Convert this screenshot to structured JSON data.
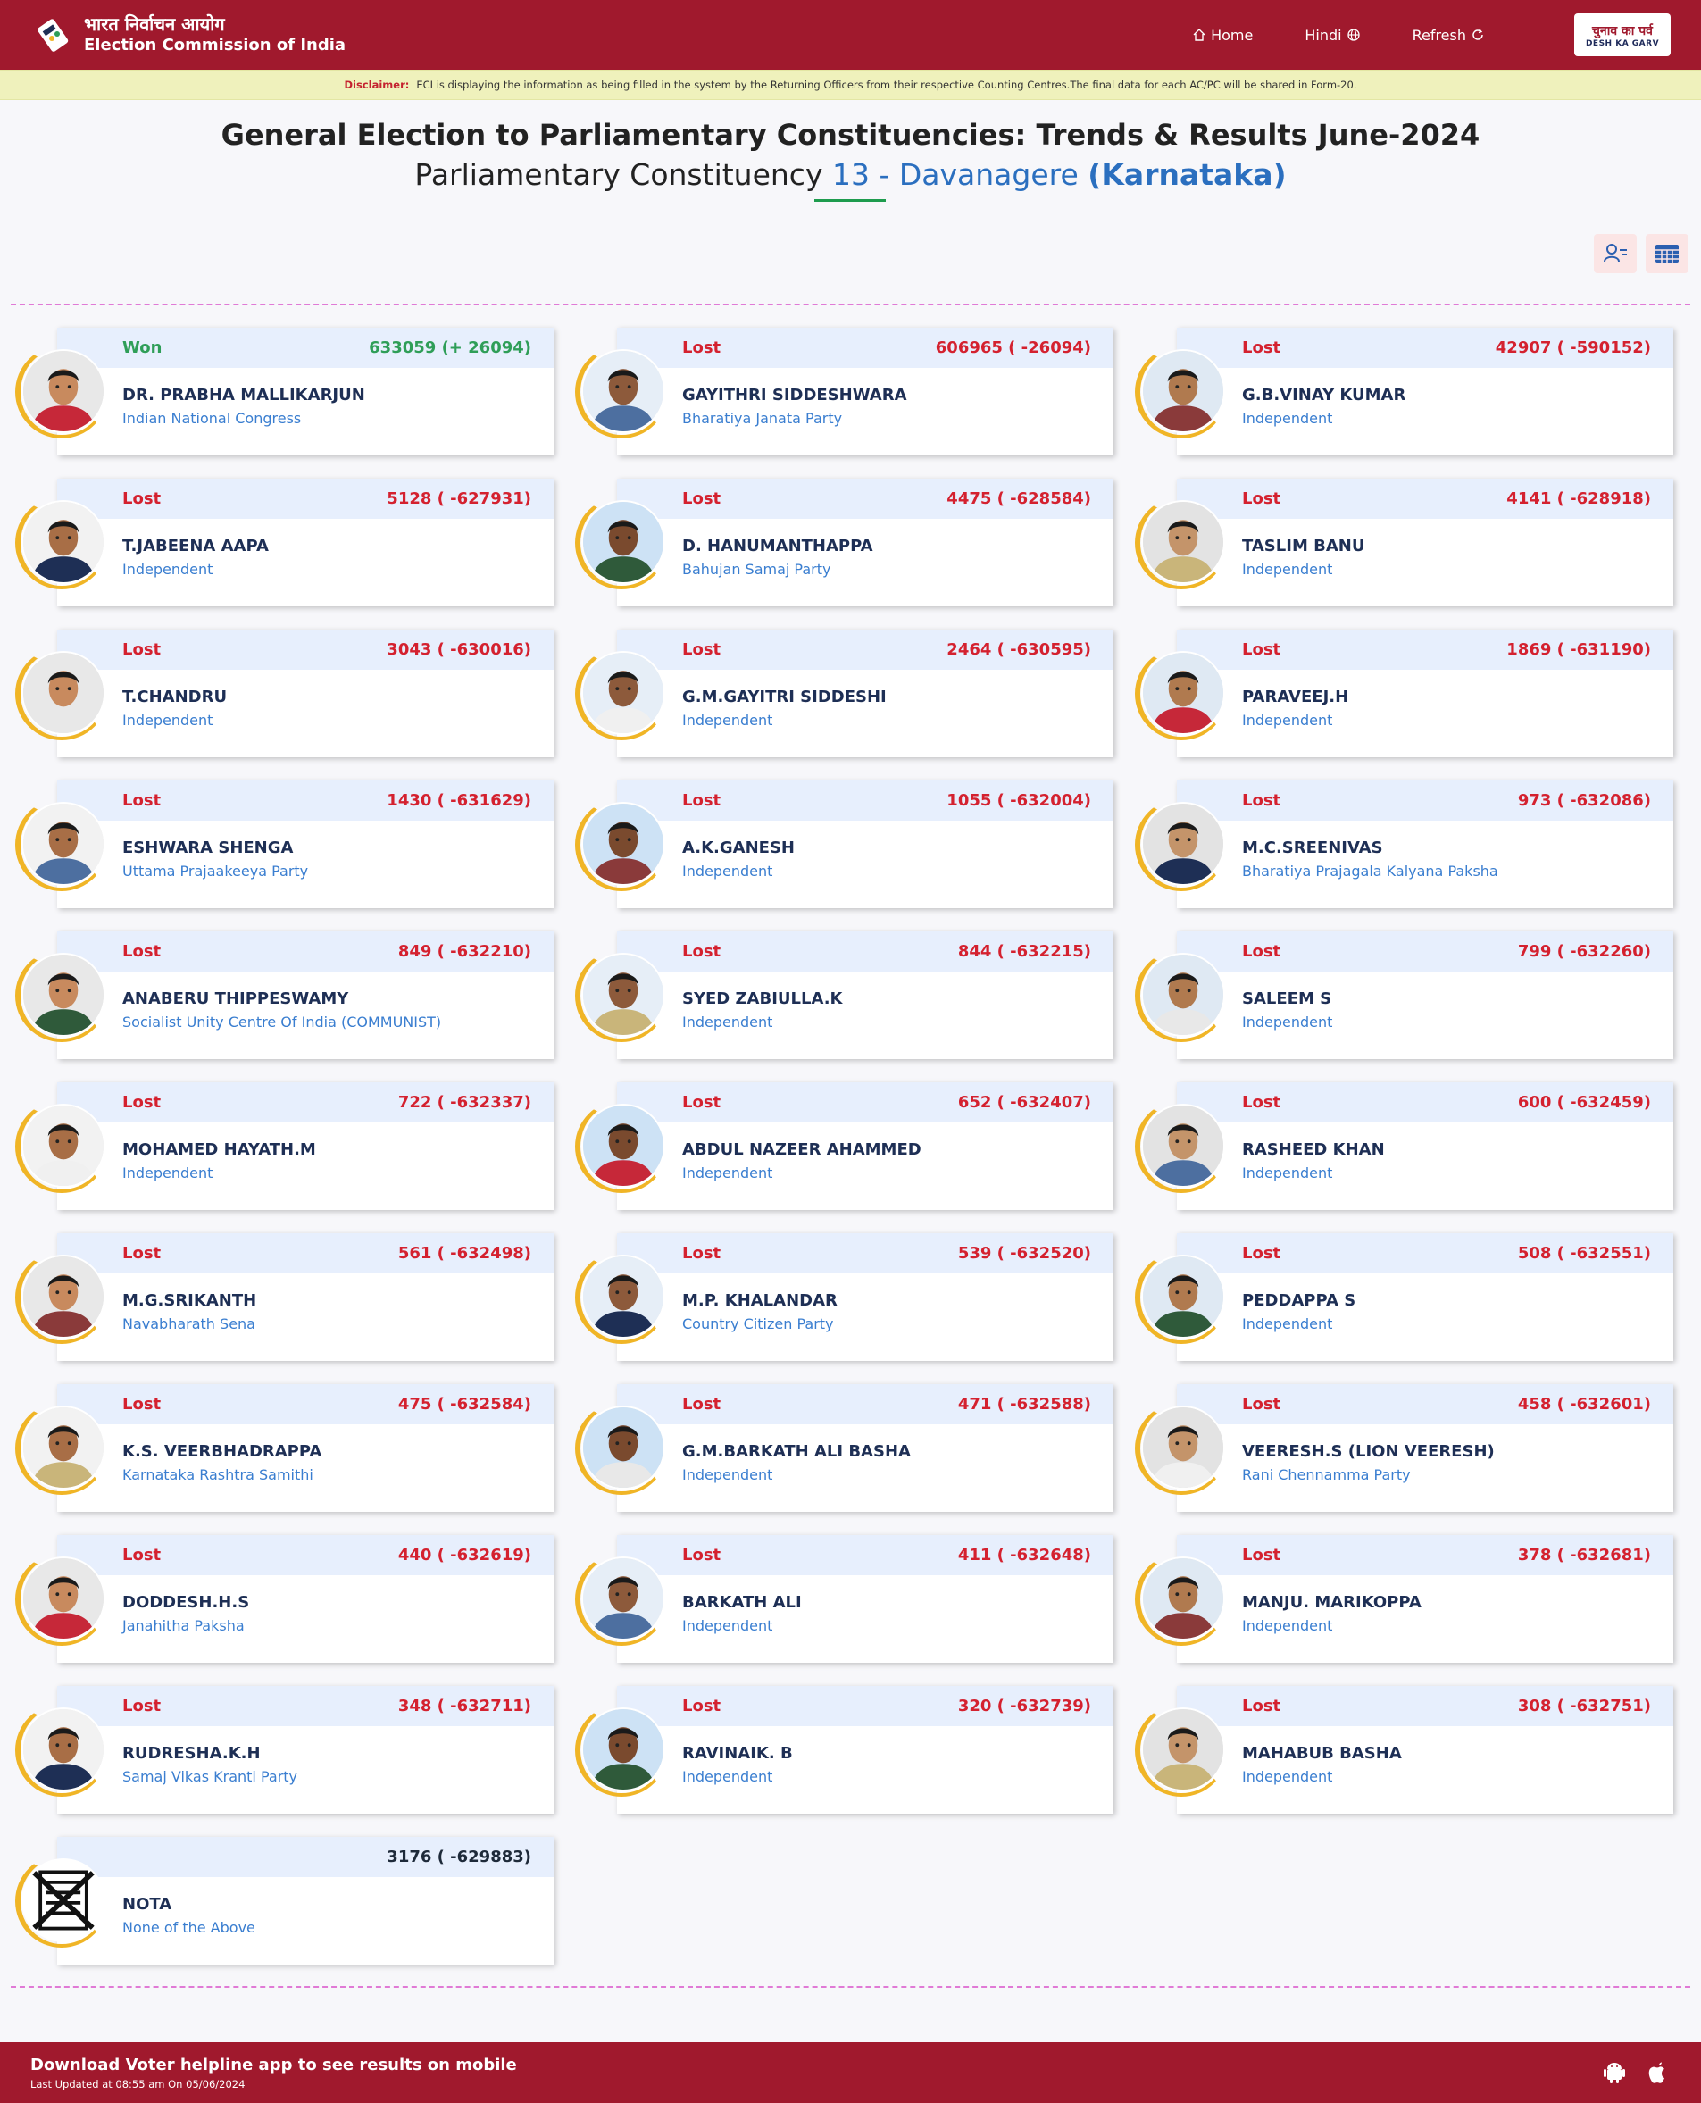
{
  "header": {
    "brand_hi": "भारत निर्वाचन आयोग",
    "brand_en": "Election Commission of India",
    "nav": {
      "home": "Home",
      "hindi": "Hindi",
      "refresh": "Refresh"
    },
    "badge_hi": "चुनाव का पर्व",
    "badge_en": "DESH KA GARV"
  },
  "disclaimer": {
    "label": "Disclaimer:",
    "text": "ECI is displaying the information as being filled in the system by the Returning Officers from their respective Counting Centres.The final data for each AC/PC will be shared in Form-20."
  },
  "page": {
    "title": "General Election to Parliamentary Constituencies: Trends & Results June-2024",
    "subtitle_prefix": "Parliamentary Constituency",
    "constituency": "13 - Davanagere",
    "state": "(Karnataka)"
  },
  "colors": {
    "header": "#a0192d",
    "won": "#2f9e58",
    "lost": "#d4212f",
    "ring": "#f0b526",
    "party": "#3a7ed0"
  },
  "candidates": [
    {
      "status": "Won",
      "votes": "633059 (+ 26094)",
      "name": "DR. PRABHA MALLIKARJUN",
      "party": "Indian National Congress"
    },
    {
      "status": "Lost",
      "votes": "606965 ( -26094)",
      "name": "GAYITHRI SIDDESHWARA",
      "party": "Bharatiya Janata Party"
    },
    {
      "status": "Lost",
      "votes": "42907 ( -590152)",
      "name": "G.B.VINAY KUMAR",
      "party": "Independent"
    },
    {
      "status": "Lost",
      "votes": "5128 ( -627931)",
      "name": "T.JABEENA AAPA",
      "party": "Independent"
    },
    {
      "status": "Lost",
      "votes": "4475 ( -628584)",
      "name": "D. HANUMANTHAPPA",
      "party": "Bahujan Samaj Party"
    },
    {
      "status": "Lost",
      "votes": "4141 ( -628918)",
      "name": "TASLIM BANU",
      "party": "Independent"
    },
    {
      "status": "Lost",
      "votes": "3043 ( -630016)",
      "name": "T.CHANDRU",
      "party": "Independent"
    },
    {
      "status": "Lost",
      "votes": "2464 ( -630595)",
      "name": "G.M.GAYITRI SIDDESHI",
      "party": "Independent"
    },
    {
      "status": "Lost",
      "votes": "1869 ( -631190)",
      "name": "PARAVEEJ.H",
      "party": "Independent"
    },
    {
      "status": "Lost",
      "votes": "1430 ( -631629)",
      "name": "ESHWARA SHENGA",
      "party": "Uttama Prajaakeeya Party"
    },
    {
      "status": "Lost",
      "votes": "1055 ( -632004)",
      "name": "A.K.GANESH",
      "party": "Independent"
    },
    {
      "status": "Lost",
      "votes": "973 ( -632086)",
      "name": "M.C.SREENIVAS",
      "party": "Bharatiya Prajagala Kalyana Paksha"
    },
    {
      "status": "Lost",
      "votes": "849 ( -632210)",
      "name": "ANABERU THIPPESWAMY",
      "party": "Socialist Unity Centre Of India (COMMUNIST)"
    },
    {
      "status": "Lost",
      "votes": "844 ( -632215)",
      "name": "SYED ZABIULLA.K",
      "party": "Independent"
    },
    {
      "status": "Lost",
      "votes": "799 ( -632260)",
      "name": "SALEEM S",
      "party": "Independent"
    },
    {
      "status": "Lost",
      "votes": "722 ( -632337)",
      "name": "MOHAMED HAYATH.M",
      "party": "Independent"
    },
    {
      "status": "Lost",
      "votes": "652 ( -632407)",
      "name": "ABDUL NAZEER AHAMMED",
      "party": "Independent"
    },
    {
      "status": "Lost",
      "votes": "600 ( -632459)",
      "name": "RASHEED KHAN",
      "party": "Independent"
    },
    {
      "status": "Lost",
      "votes": "561 ( -632498)",
      "name": "M.G.SRIKANTH",
      "party": "Navabharath Sena"
    },
    {
      "status": "Lost",
      "votes": "539 ( -632520)",
      "name": "M.P. KHALANDAR",
      "party": "Country Citizen Party"
    },
    {
      "status": "Lost",
      "votes": "508 ( -632551)",
      "name": "PEDDAPPA S",
      "party": "Independent"
    },
    {
      "status": "Lost",
      "votes": "475 ( -632584)",
      "name": "K.S. VEERBHADRAPPA",
      "party": "Karnataka Rashtra Samithi"
    },
    {
      "status": "Lost",
      "votes": "471 ( -632588)",
      "name": "G.M.BARKATH ALI BASHA",
      "party": "Independent"
    },
    {
      "status": "Lost",
      "votes": "458 ( -632601)",
      "name": "VEERESH.S (LION VEERESH)",
      "party": "Rani Chennamma Party"
    },
    {
      "status": "Lost",
      "votes": "440 ( -632619)",
      "name": "DODDESH.H.S",
      "party": "Janahitha Paksha"
    },
    {
      "status": "Lost",
      "votes": "411 ( -632648)",
      "name": "BARKATH ALI",
      "party": "Independent"
    },
    {
      "status": "Lost",
      "votes": "378 ( -632681)",
      "name": "MANJU. MARIKOPPA",
      "party": "Independent"
    },
    {
      "status": "Lost",
      "votes": "348 ( -632711)",
      "name": "RUDRESHA.K.H",
      "party": "Samaj Vikas Kranti Party"
    },
    {
      "status": "Lost",
      "votes": "320 ( -632739)",
      "name": "RAVINAIK. B",
      "party": "Independent"
    },
    {
      "status": "Lost",
      "votes": "308 ( -632751)",
      "name": "MAHABUB BASHA",
      "party": "Independent"
    },
    {
      "status": "",
      "votes": "3176 ( -629883)",
      "name": "NOTA",
      "party": "None of the Above",
      "nota": true
    }
  ],
  "footer": {
    "line1": "Download Voter helpline app to see results on mobile",
    "line2": "Last Updated at 08:55 am On 05/06/2024"
  }
}
